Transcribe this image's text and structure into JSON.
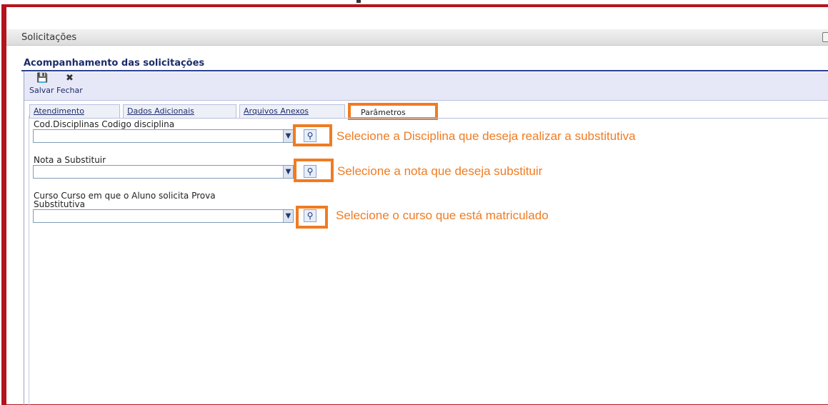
{
  "window": {
    "title": "Solicitações"
  },
  "heading": "Acompanhamento das solicitações",
  "toolbar": {
    "save_label": "Salvar",
    "close_label": "Fechar"
  },
  "tabs": [
    {
      "label": "Atendimento"
    },
    {
      "label": "Dados Adicionais"
    },
    {
      "label": "Arquivos Anexos"
    },
    {
      "label": "Parâmetros"
    }
  ],
  "fields": [
    {
      "label": "Cod.Disciplinas Codigo disciplina",
      "value": "",
      "note": "Selecione a Disciplina que deseja realizar a substitutiva"
    },
    {
      "label": "Nota a Substituir",
      "value": "",
      "note": "Selecione a  nota que deseja substituir"
    },
    {
      "label_line1": "Curso Curso em que o Aluno solicita Prova",
      "label_line2": "Substitutiva",
      "value": "",
      "note": "Selecione o curso que está matriculado"
    }
  ],
  "colors": {
    "frame": "#b4141c",
    "highlight": "#f07c22",
    "heading": "#1c2d6b"
  },
  "icons": {
    "save": "save-icon",
    "close": "close-icon",
    "lookup": "magnifier-icon",
    "dropdown": "chevron-down-icon"
  }
}
